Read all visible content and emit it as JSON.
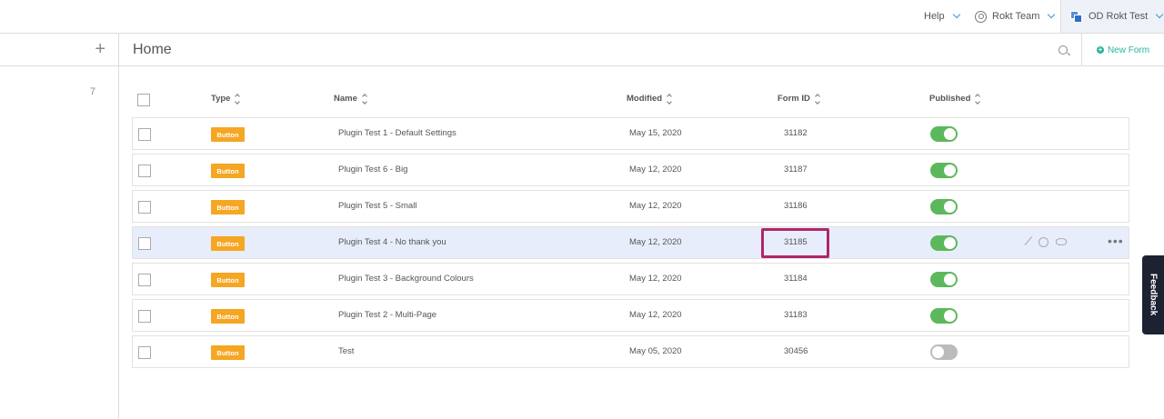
{
  "topbar": {
    "help": "Help",
    "team": "Rokt Team",
    "org": "OD Rokt Test"
  },
  "sidebar": {
    "add_symbol": "+",
    "count": "7"
  },
  "header": {
    "title": "Home",
    "new_form": "New Form"
  },
  "table": {
    "columns": [
      "Type",
      "Name",
      "Modified",
      "Form ID",
      "Published"
    ],
    "rows": [
      {
        "type": "Button",
        "name": "Plugin Test 1 - Default Settings",
        "modified": "May 15, 2020",
        "form_id": "31182",
        "published": true
      },
      {
        "type": "Button",
        "name": "Plugin Test 6 - Big",
        "modified": "May 12, 2020",
        "form_id": "31187",
        "published": true
      },
      {
        "type": "Button",
        "name": "Plugin Test 5 - Small",
        "modified": "May 12, 2020",
        "form_id": "31186",
        "published": true
      },
      {
        "type": "Button",
        "name": "Plugin Test 4 - No thank you",
        "modified": "May 12, 2020",
        "form_id": "31185",
        "published": true
      },
      {
        "type": "Button",
        "name": "Plugin Test 3 - Background Colours",
        "modified": "May 12, 2020",
        "form_id": "31184",
        "published": true
      },
      {
        "type": "Button",
        "name": "Plugin Test 2 - Multi-Page",
        "modified": "May 12, 2020",
        "form_id": "31183",
        "published": true
      },
      {
        "type": "Button",
        "name": "Test",
        "modified": "May 05, 2020",
        "form_id": "30456",
        "published": false
      }
    ],
    "more_symbol": "•••"
  },
  "feedback": "Feedback",
  "colors": {
    "badge": "#f5a623",
    "toggle_on": "#5cb85c",
    "highlight": "#b0266a",
    "accent": "#2bb3a0"
  }
}
